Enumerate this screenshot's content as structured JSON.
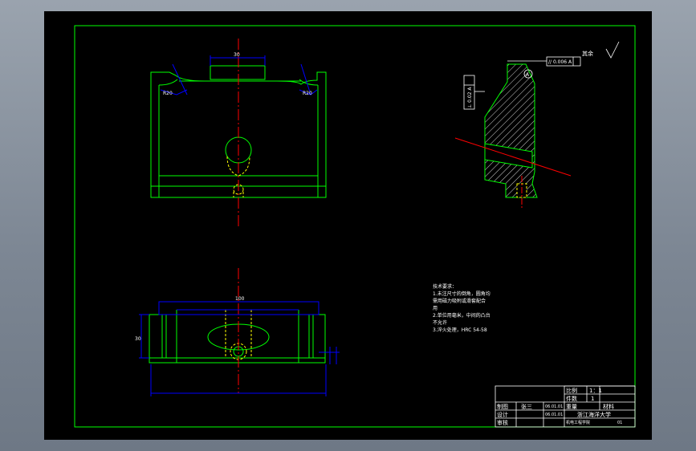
{
  "colors": {
    "background": "#000000",
    "frame": "#00ff00",
    "outline": "#00ff00",
    "centerline": "#ff0000",
    "dimension": "#0000ff",
    "hidden": "#ffff00",
    "text": "#ffffff"
  },
  "annotations": {
    "parallelism": "// 0.006 A",
    "datum": "A",
    "perpendicularity": "⊥ 0.02 A",
    "roughness_rest": "其余"
  },
  "notes": {
    "heading": "技术要求：",
    "line1": "1.未注尺寸的倒角，圆角均",
    "line2": "需用磁力吸附或滑套配合",
    "line3": "用",
    "line4": "2.单位用毫米，中间的凸台",
    "line5": "不允许",
    "line6": "3.淬火处理，HRC 54-58"
  },
  "title_block": {
    "scale_label": "比例",
    "scale_value": "1：1",
    "qty_label": "件数",
    "qty_value": "1",
    "weight_label": "重量",
    "material_label": "材料",
    "drawn_label": "制图",
    "designed_label": "设计",
    "checked_label": "审核",
    "drawer_name": "张三",
    "date1": "06.01.01",
    "date2": "06.01.01",
    "school": "浙江海洋大学",
    "dept": "机电工程学院",
    "drawing_no": "01"
  }
}
